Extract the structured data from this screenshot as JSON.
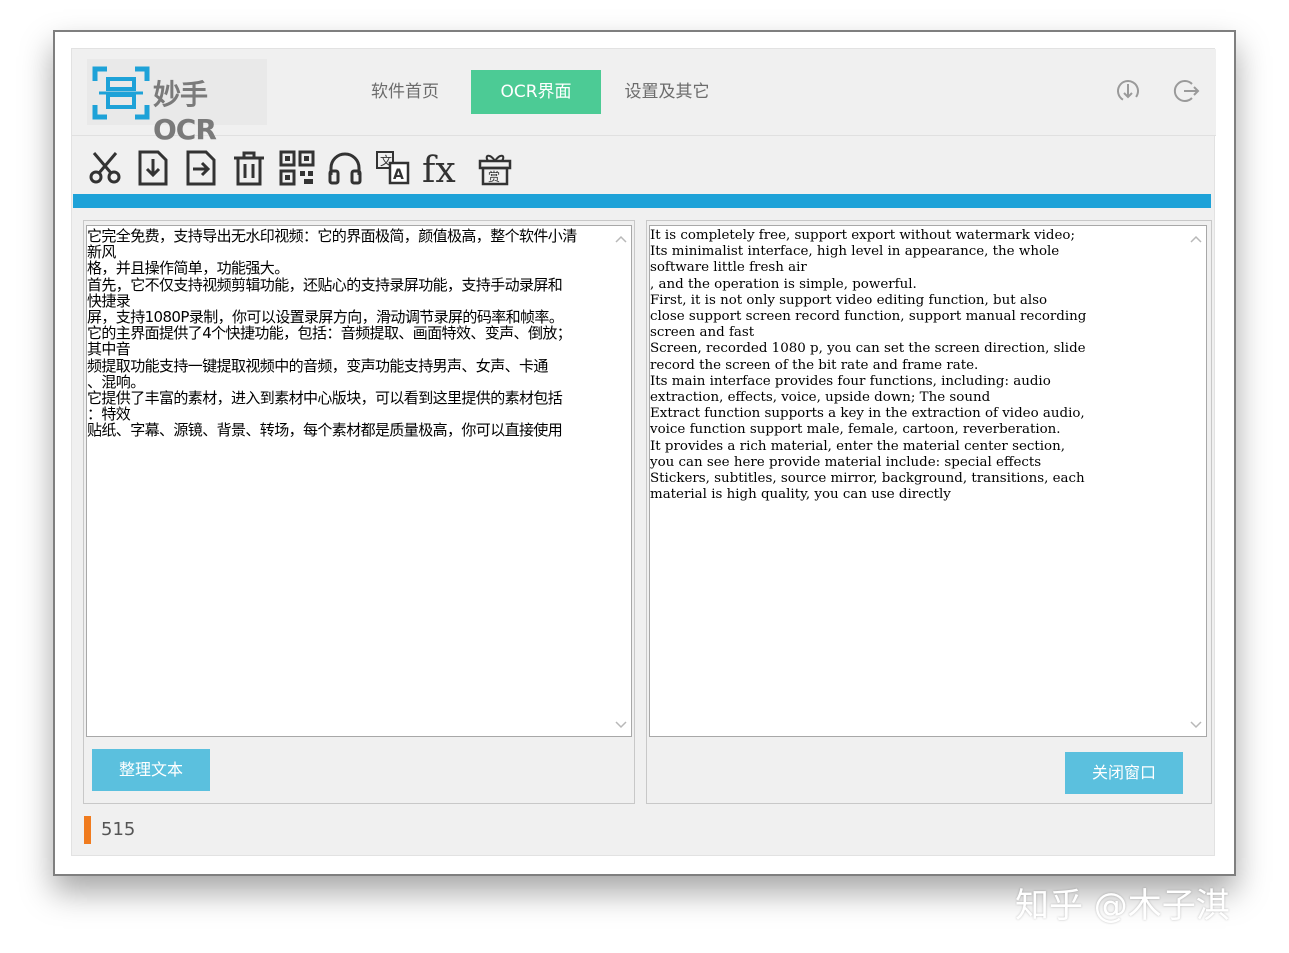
{
  "app": {
    "logo_text": "妙手OCR",
    "brand_color": "#1ea2d8"
  },
  "nav": {
    "tabs": [
      {
        "label": "软件首页",
        "active": false
      },
      {
        "label": "OCR界面",
        "active": true
      },
      {
        "label": "设置及其它",
        "active": false
      }
    ],
    "active_color": "#4ccb95"
  },
  "header_icons": [
    "download-icon",
    "logout-icon"
  ],
  "toolbar": {
    "icons": [
      "scissors-icon",
      "import-icon",
      "export-icon",
      "trash-icon",
      "qr-code-icon",
      "headphones-icon",
      "translate-icon",
      "formula-icon",
      "gift-icon"
    ]
  },
  "left_pane": {
    "lines": [
      "它完全免费，支持导出无水印视频：它的界面极简，颜值极高，整个软件小清",
      "新风",
      "格，并且操作简单，功能强大。",
      "首先，它不仅支持视频剪辑功能，还贴心的支持录屏功能，支持手动录屏和",
      "快捷录",
      "屏，支持1080P录制，你可以设置录屏方向，滑动调节录屏的码率和帧率。",
      "它的主界面提供了4个快捷功能，包括：音频提取、画面特效、变声、倒放；",
      "其中音",
      "频提取功能支持一键提取视频中的音频，变声功能支持男声、女声、卡通",
      "、混响。",
      "它提供了丰富的素材，进入到素材中心版块，可以看到这里提供的素材包括",
      "：特效",
      "贴纸、字幕、源镜、背景、转场，每个素材都是质量极高，你可以直接使用"
    ],
    "button_label": "整理文本"
  },
  "right_pane": {
    "lines": [
      "It is completely free, support export without watermark video;",
      "Its minimalist interface, high level in appearance, the whole",
      "software little fresh air",
      ", and the operation is simple, powerful.",
      "First, it is not only support video editing function, but also",
      "close support screen record function, support manual recording",
      "screen and fast",
      "Screen, recorded 1080 p, you can set the screen direction, slide",
      "record the screen of the bit rate and frame rate.",
      "Its main interface provides four functions, including: audio",
      "extraction, effects, voice, upside down; The sound",
      "Extract function supports a key in the extraction of video audio,",
      "voice function support male, female, cartoon, reverberation.",
      "It provides a rich material, enter the material center section,",
      "you can see here provide material include: special effects",
      "Stickers, subtitles, source mirror, background, transitions, each",
      "material is high quality, you can use directly"
    ],
    "button_label": "关闭窗口"
  },
  "status": {
    "count": "515",
    "marker_color": "#f07b1e"
  },
  "watermark": "知乎 @木子淇"
}
